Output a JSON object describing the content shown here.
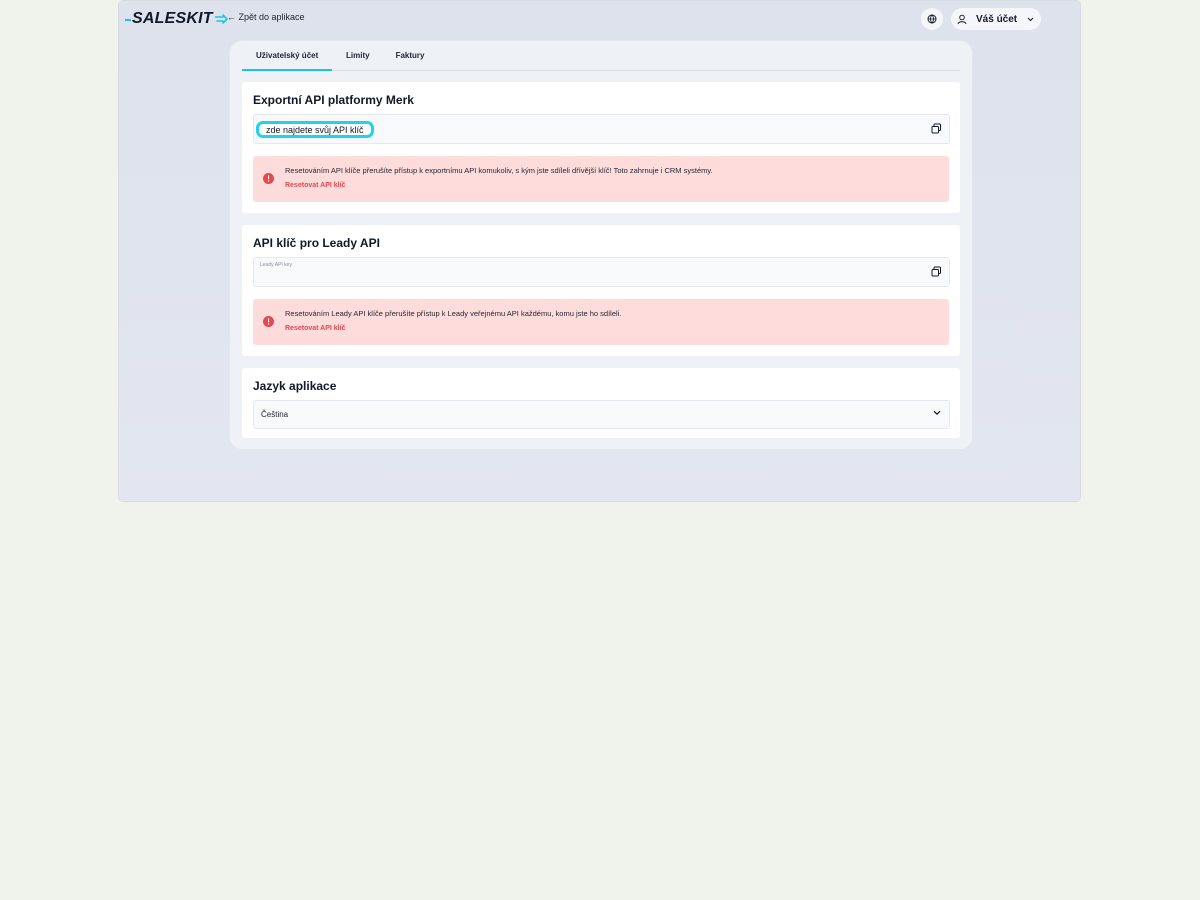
{
  "header": {
    "logo_text": "SALESKIT",
    "back_label": "← Zpět do aplikace",
    "account_label": "Váš účet",
    "colors": {
      "brand_accent": "#18c6e0",
      "danger": "#e5484d",
      "alert_bg": "#fedcdc"
    }
  },
  "tabs": [
    {
      "label": "Uživatelský účet",
      "active": true
    },
    {
      "label": "Limity",
      "active": false
    },
    {
      "label": "Faktury",
      "active": false
    }
  ],
  "merk_api": {
    "title": "Exportní API platformy Merk",
    "highlight_text": "zde najdete svůj API klíč",
    "alert_text": "Resetováním API klíče přerušíte přístup k exportnímu API komukoliv, s kým jste sdíleli dřívější klíč! Toto zahrnuje i CRM systémy.",
    "reset_label": "Resetovat API klíč"
  },
  "leady_api": {
    "title": "API klíč pro Leady API",
    "field_label": "Leady API key",
    "alert_text": "Resetováním Leady API klíče přerušíte přístup k Leady veřejnému API každému, komu jste ho sdíleli.",
    "reset_label": "Resetovat API klíč"
  },
  "language": {
    "title": "Jazyk aplikace",
    "selected": "Čeština"
  },
  "icons": [
    "arrow-left-icon",
    "globe-icon",
    "user-icon",
    "chevron-down-icon",
    "copy-icon",
    "alert-circle-icon"
  ]
}
